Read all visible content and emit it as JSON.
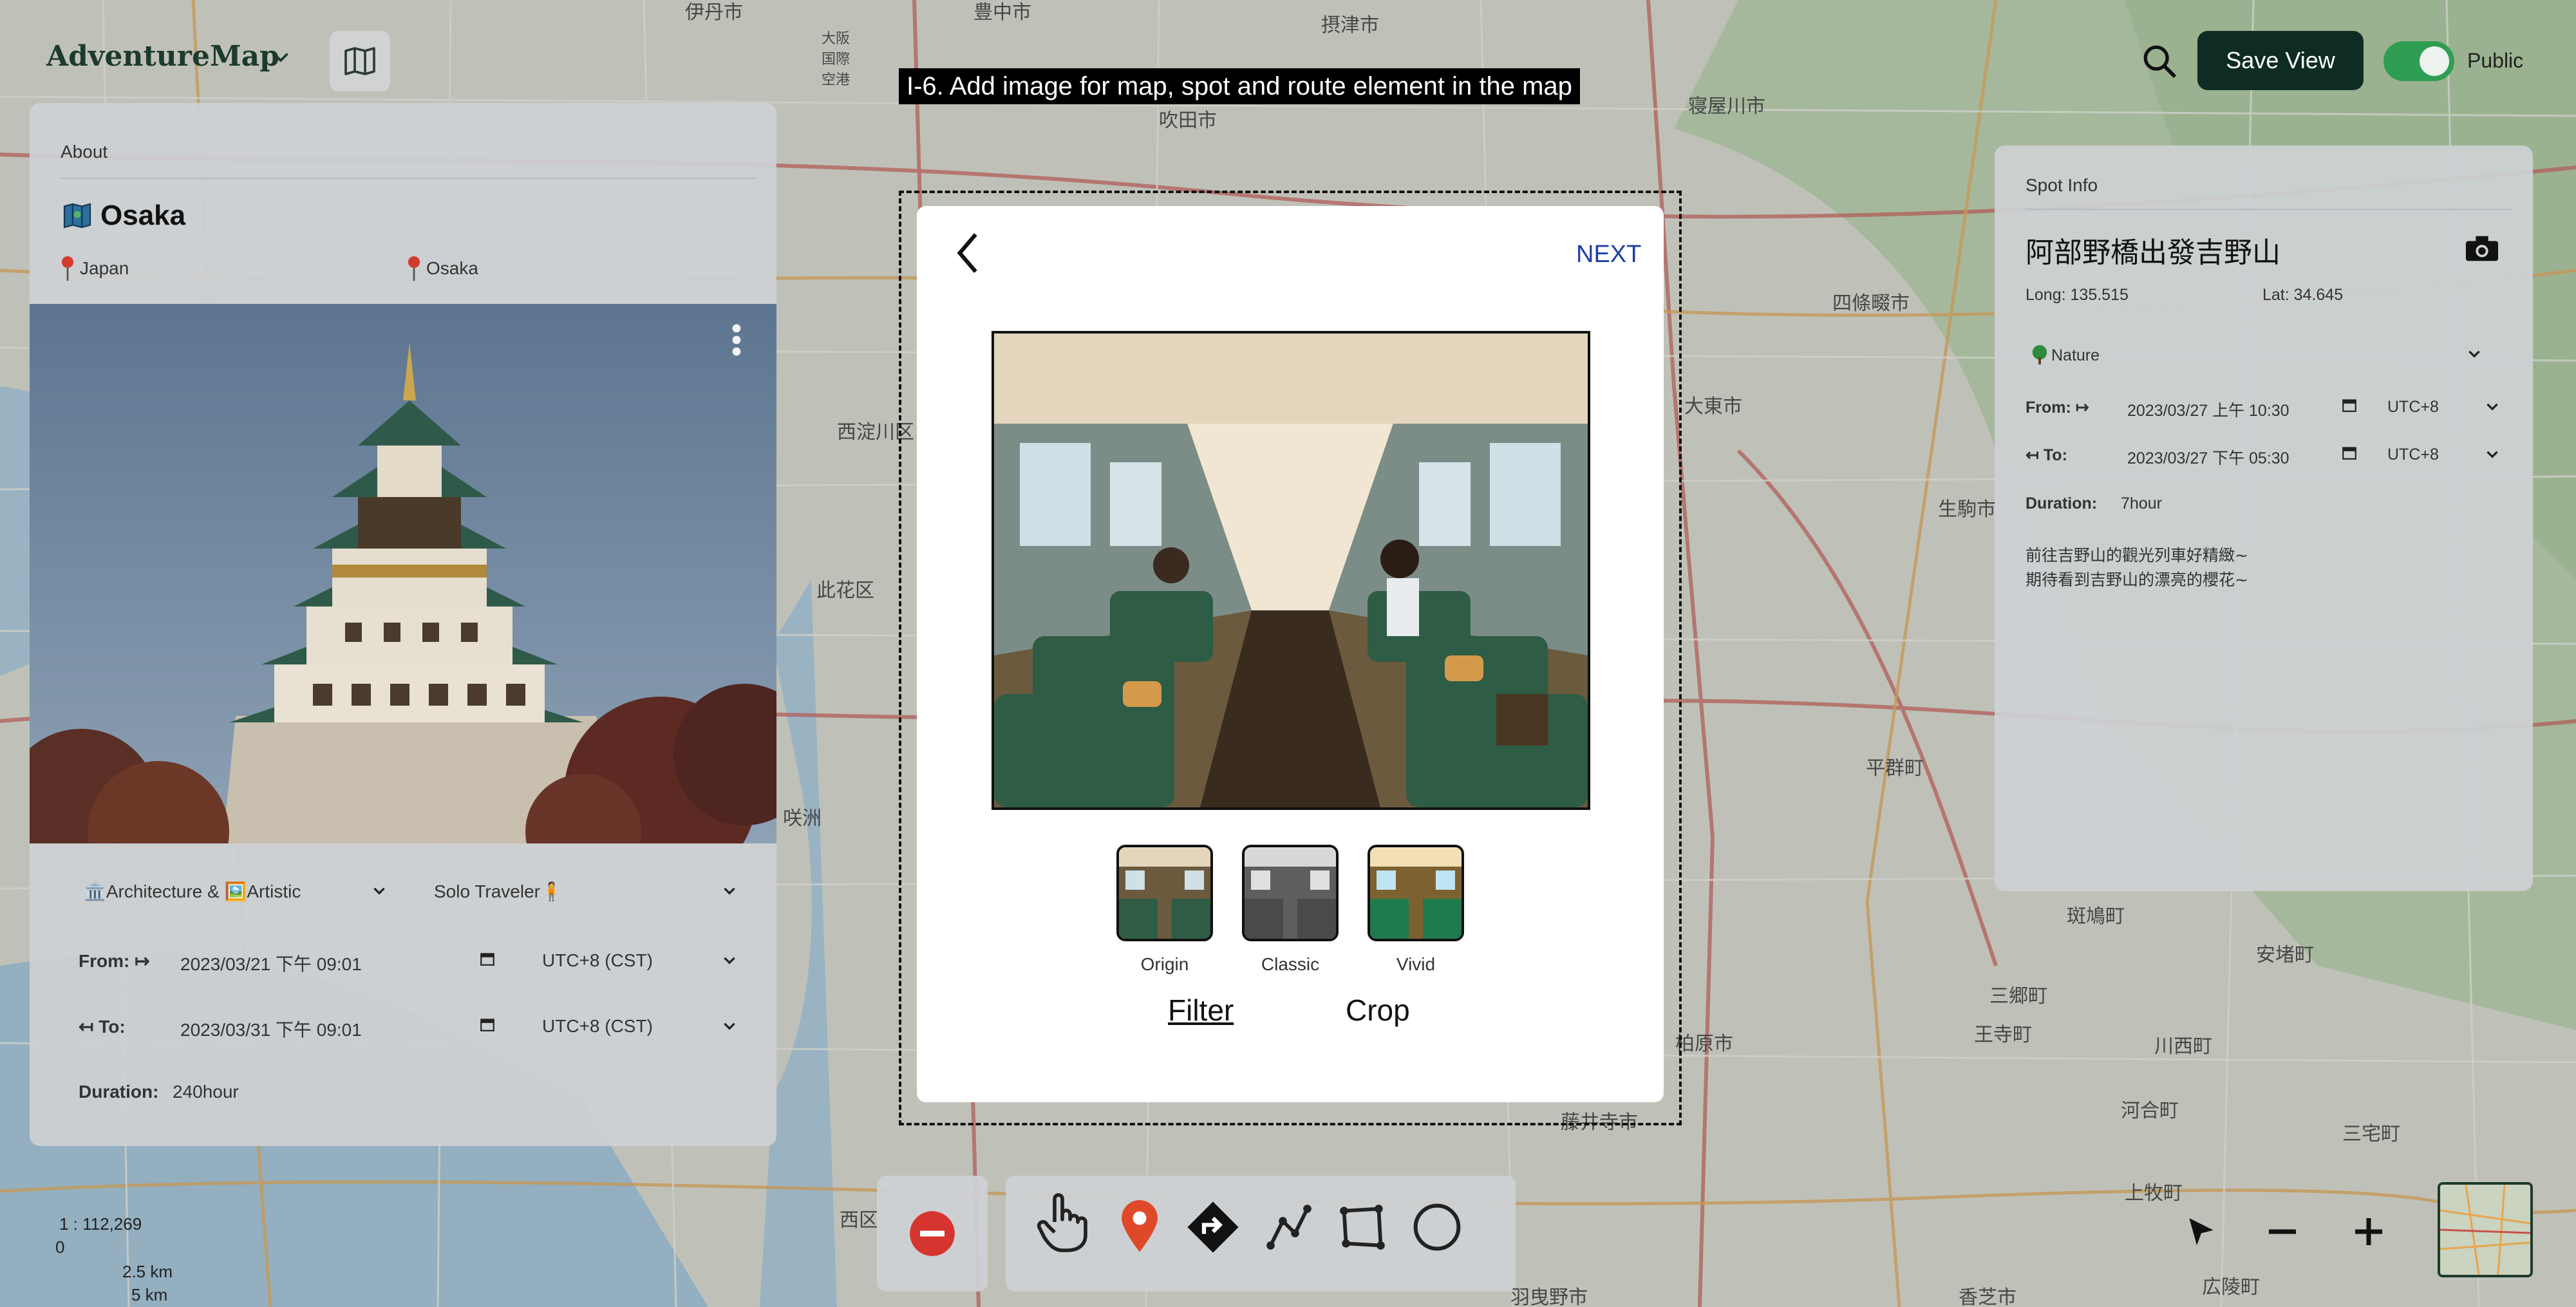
{
  "app": {
    "brand": "AdventureMap",
    "save_view": "Save View",
    "public_label": "Public",
    "public_on": true
  },
  "annotation": "I-6. Add image for map, spot and route element in the map",
  "map_labels": [
    {
      "text": "伊丹市"
    },
    {
      "text": "豊中市"
    },
    {
      "text": "摂津市"
    },
    {
      "text": "吹田市"
    },
    {
      "text": "寝屋川市"
    },
    {
      "text": "四條畷市"
    },
    {
      "text": "大東市"
    },
    {
      "text": "生駒市"
    },
    {
      "text": "西淀川区"
    },
    {
      "text": "此花区"
    },
    {
      "text": "咲洲"
    },
    {
      "text": "平群町"
    },
    {
      "text": "斑鳩町"
    },
    {
      "text": "安堵町"
    },
    {
      "text": "三郷町"
    },
    {
      "text": "王寺町"
    },
    {
      "text": "川西町"
    },
    {
      "text": "三宅町"
    },
    {
      "text": "河合町"
    },
    {
      "text": "柏原市"
    },
    {
      "text": "藤井寺市"
    },
    {
      "text": "上牧町"
    },
    {
      "text": "広陵町"
    },
    {
      "text": "香芝市"
    },
    {
      "text": "羽曳野市"
    },
    {
      "text": "西区"
    },
    {
      "text": "大阪国際空港"
    }
  ],
  "about": {
    "section_title": "About",
    "trip_name": "Osaka",
    "country": "Japan",
    "city": "Osaka",
    "category": "🏛️Architecture & 🖼️Artistic",
    "traveler": "Solo Traveler🧍",
    "from_label": "From: ↦",
    "from_value": "2023/03/21 下午 09:01",
    "from_tz": "UTC+8 (CST)",
    "to_label": "↤ To:",
    "to_value": "2023/03/31 下午 09:01",
    "to_tz": "UTC+8 (CST)",
    "duration_label": "Duration:",
    "duration_value": "240hour"
  },
  "spot": {
    "section_title": "Spot Info",
    "name": "阿部野橋出發吉野山",
    "long": "Long: 135.515",
    "lat": "Lat: 34.645",
    "category": "Nature",
    "from_label": "From: ↦",
    "from_value": "2023/03/27 上午 10:30",
    "from_tz": "UTC+8",
    "to_label": "↤ To:",
    "to_value": "2023/03/27 下午 05:30",
    "to_tz": "UTC+8",
    "duration_label": "Duration:",
    "duration_value": "7hour",
    "description_lines": [
      "前往吉野山的觀光列車好精緻~",
      "期待看到吉野山的漂亮的櫻花~"
    ]
  },
  "modal": {
    "next": "NEXT",
    "filters": [
      {
        "label": "Origin"
      },
      {
        "label": "Classic"
      },
      {
        "label": "Vivid"
      }
    ],
    "tab_filter": "Filter",
    "tab_crop": "Crop"
  },
  "scale": {
    "ratio": "1 : 112,269",
    "zero": "0",
    "km1": "2.5 km",
    "km2": "5 km"
  },
  "icons": {
    "remove": "remove-circle-icon",
    "tools": [
      "hand-pointer-icon",
      "map-pin-icon",
      "route-diamond-icon",
      "polyline-icon",
      "polygon-icon",
      "circle-icon"
    ],
    "controls": [
      "cursor-arrow-icon",
      "zoom-out-icon",
      "zoom-in-icon"
    ]
  },
  "colors": {
    "brand": "#1d3b2c",
    "save_button": "#0f2c24",
    "toggle_on": "#2e9e53",
    "next_link": "#1e3fa5",
    "pin_red": "#e0482a",
    "remove_red": "#d6342e"
  }
}
